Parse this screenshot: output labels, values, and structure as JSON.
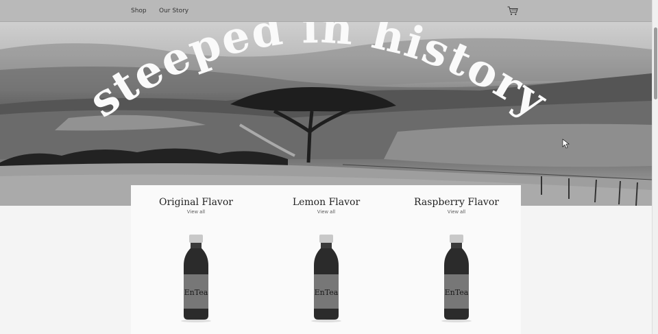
{
  "nav": {
    "links": [
      "Shop",
      "Our Story"
    ],
    "cart_icon": "cart-icon"
  },
  "hero": {
    "headline": "steeped in history"
  },
  "products": [
    {
      "title": "Original Flavor",
      "link": "View all",
      "brand": "EnTea"
    },
    {
      "title": "Lemon Flavor",
      "link": "View all",
      "brand": "EnTea"
    },
    {
      "title": "Raspberry Flavor",
      "link": "View all",
      "brand": "EnTea"
    }
  ]
}
